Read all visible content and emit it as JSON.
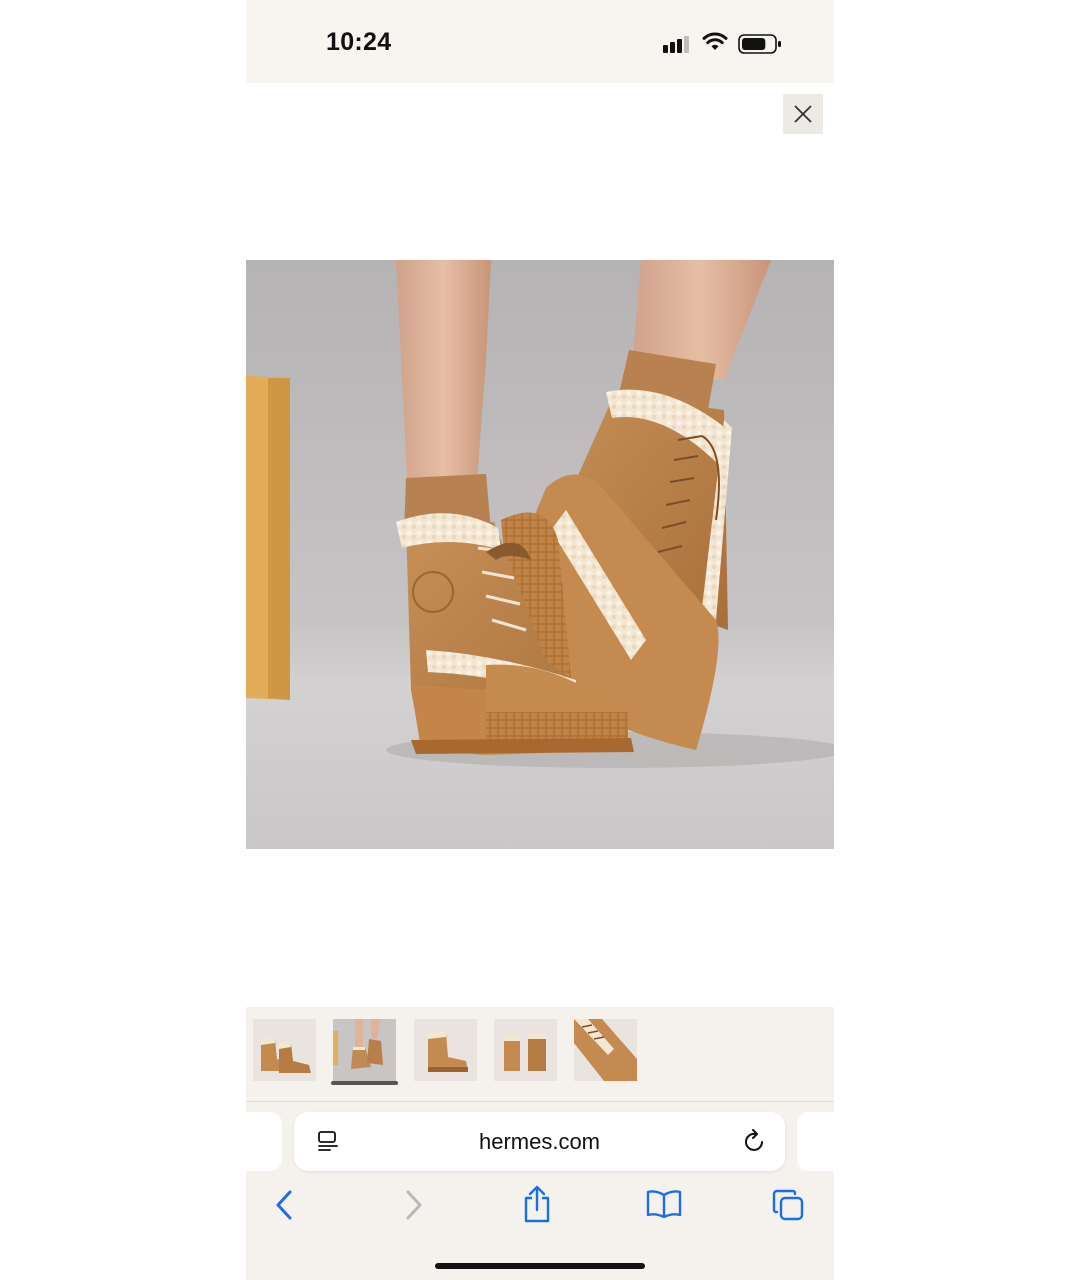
{
  "status_bar": {
    "time": "10:24",
    "battery_level": 0.75
  },
  "viewer": {
    "close_icon": "close-icon",
    "main_image": "boots-photo",
    "thumbnails": [
      {
        "icon": "boots-thumb-1",
        "selected": false
      },
      {
        "icon": "boots-thumb-2",
        "selected": true
      },
      {
        "icon": "boots-thumb-3",
        "selected": false
      },
      {
        "icon": "boots-thumb-4",
        "selected": false
      },
      {
        "icon": "boots-thumb-5",
        "selected": false
      }
    ]
  },
  "browser": {
    "url": "hermes.com",
    "toolbar": [
      "back-icon",
      "forward-icon",
      "share-icon",
      "bookmarks-icon",
      "tabs-icon"
    ]
  },
  "colors": {
    "accent": "#1a6fe8",
    "disabled": "#b9b9b9",
    "leather": "#c48a4f"
  }
}
